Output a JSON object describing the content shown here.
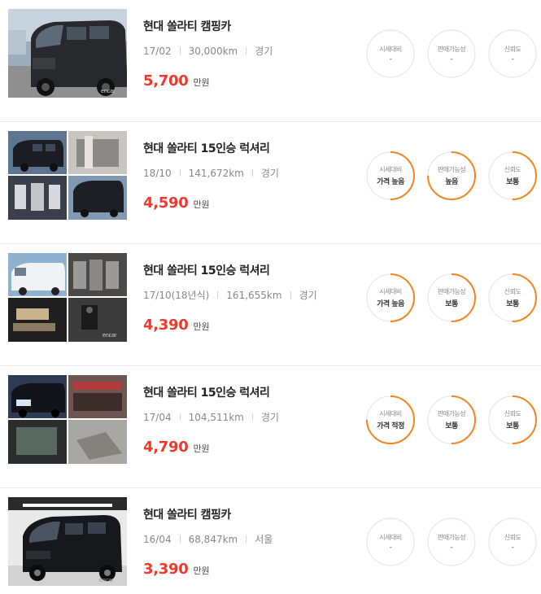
{
  "listings": [
    {
      "title": "현대 쏠라티 캠핑카",
      "year": "17/02",
      "mileage": "30,000km",
      "region": "경기",
      "price": "5,700",
      "price_unit": "만원",
      "photo_style": "single",
      "metrics": [
        {
          "label": "시세대비",
          "value": "-",
          "fraction": 0
        },
        {
          "label": "판매가능성",
          "value": "-",
          "fraction": 0
        },
        {
          "label": "신뢰도",
          "value": "-",
          "fraction": 0
        }
      ]
    },
    {
      "title": "현대 쏠라티 15인승 럭셔리",
      "year": "18/10",
      "mileage": "141,672km",
      "region": "경기",
      "price": "4,590",
      "price_unit": "만원",
      "photo_style": "grid",
      "metrics": [
        {
          "label": "시세대비",
          "value": "가격 높음",
          "fraction": 0.5
        },
        {
          "label": "판매가능성",
          "value": "높음",
          "fraction": 0.75
        },
        {
          "label": "신뢰도",
          "value": "보통",
          "fraction": 0.5
        }
      ]
    },
    {
      "title": "현대 쏠라티 15인승 럭셔리",
      "year": "17/10(18년식)",
      "mileage": "161,655km",
      "region": "경기",
      "price": "4,390",
      "price_unit": "만원",
      "photo_style": "grid",
      "metrics": [
        {
          "label": "시세대비",
          "value": "가격 높음",
          "fraction": 0.5
        },
        {
          "label": "판매가능성",
          "value": "보통",
          "fraction": 0.5
        },
        {
          "label": "신뢰도",
          "value": "보통",
          "fraction": 0.5
        }
      ]
    },
    {
      "title": "현대 쏠라티 15인승 럭셔리",
      "year": "17/04",
      "mileage": "104,511km",
      "region": "경기",
      "price": "4,790",
      "price_unit": "만원",
      "photo_style": "grid",
      "metrics": [
        {
          "label": "시세대비",
          "value": "가격 적정",
          "fraction": 0.75
        },
        {
          "label": "판매가능성",
          "value": "보통",
          "fraction": 0.5
        },
        {
          "label": "신뢰도",
          "value": "보통",
          "fraction": 0.5
        }
      ]
    },
    {
      "title": "현대 쏠라티 캠핑카",
      "year": "16/04",
      "mileage": "68,847km",
      "region": "서울",
      "price": "3,390",
      "price_unit": "만원",
      "photo_style": "studio",
      "metrics": [
        {
          "label": "시세대비",
          "value": "-",
          "fraction": 0
        },
        {
          "label": "판매가능성",
          "value": "-",
          "fraction": 0
        },
        {
          "label": "신뢰도",
          "value": "-",
          "fraction": 0
        }
      ]
    }
  ],
  "colors": {
    "price": "#f2372b",
    "ring_active": "#f5841f",
    "ring_track": "#e6e6e6",
    "divider": "#e9e9e9"
  },
  "icons": {
    "photo": "van-photo",
    "separator": "meta-separator"
  }
}
